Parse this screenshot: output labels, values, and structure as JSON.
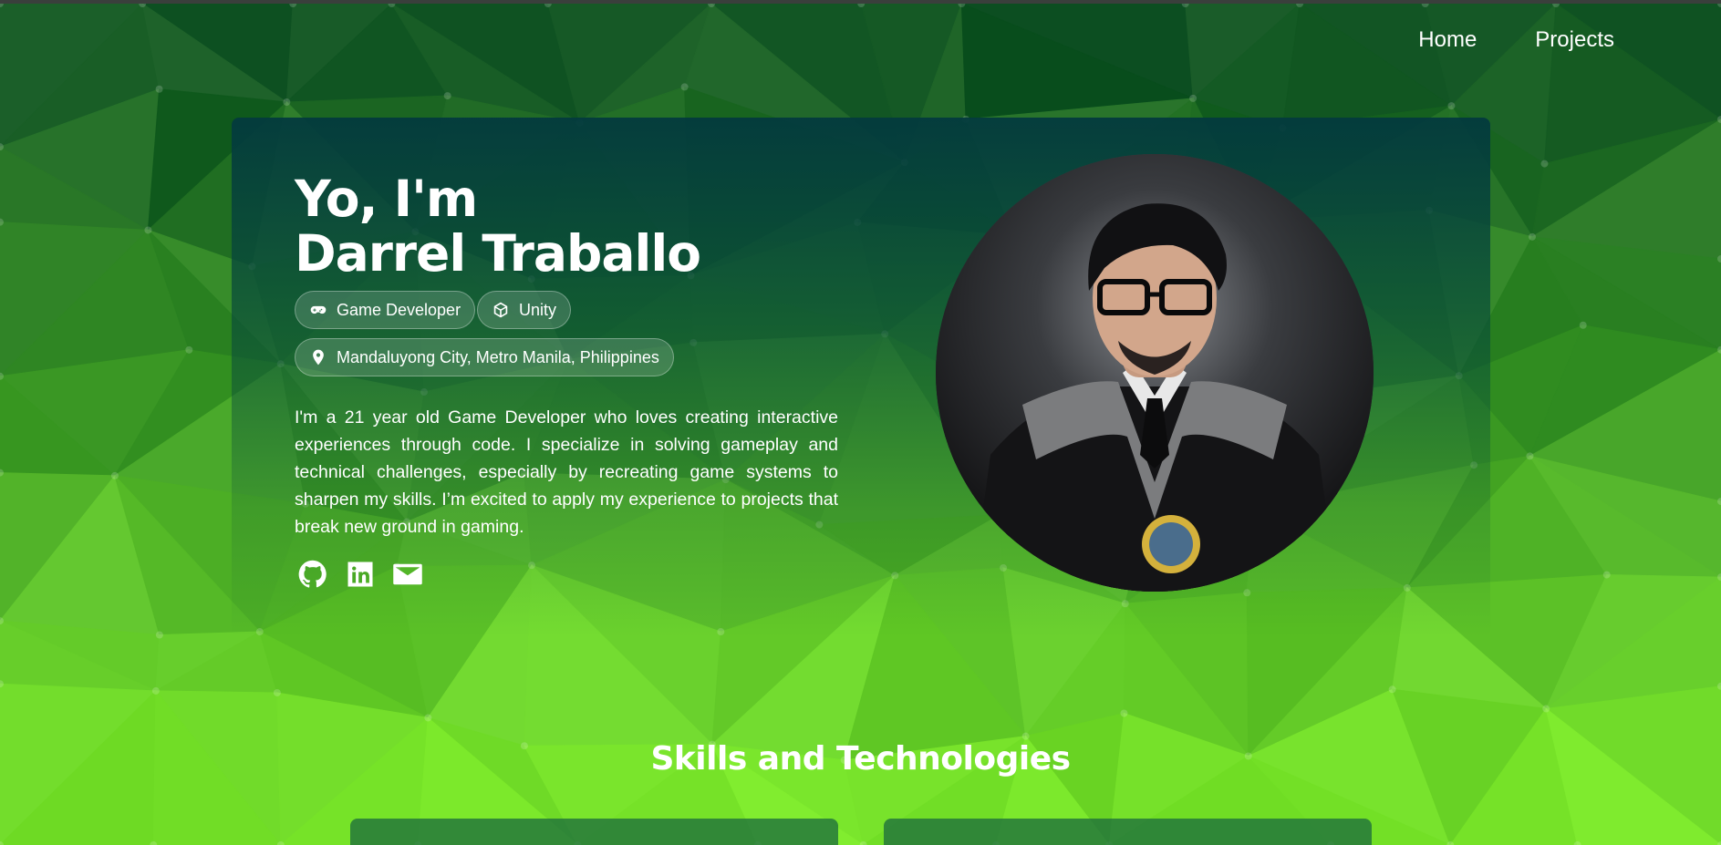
{
  "nav": {
    "home": "Home",
    "projects": "Projects"
  },
  "hero": {
    "greeting": "Yo, I'm",
    "name": "Darrel Traballo",
    "tags": [
      {
        "label": "Game Developer",
        "icon": "gamepad-icon"
      },
      {
        "label": "Unity",
        "icon": "unity-icon"
      }
    ],
    "location": {
      "label": "Mandaluyong City, Metro Manila, Philippines",
      "icon": "location-pin-icon"
    },
    "about": "I'm a 21 year old Game Developer who loves creating interactive experiences through code. I specialize in solving gameplay and technical challenges, especially by recreating game systems to sharpen my skills. I’m excited to apply my experience to projects that break new ground in gaming.",
    "socials": [
      {
        "name": "GitHub",
        "icon": "github-icon"
      },
      {
        "name": "LinkedIn",
        "icon": "linkedin-icon"
      },
      {
        "name": "Email",
        "icon": "mail-icon"
      }
    ],
    "portrait_icon": "profile-photo"
  },
  "skills": {
    "title": "Skills and Technologies"
  },
  "colors": {
    "background_top": "#0a4a22",
    "background_bottom": "#86f42d",
    "card_top": "#033a3e",
    "text": "#ffffff"
  }
}
